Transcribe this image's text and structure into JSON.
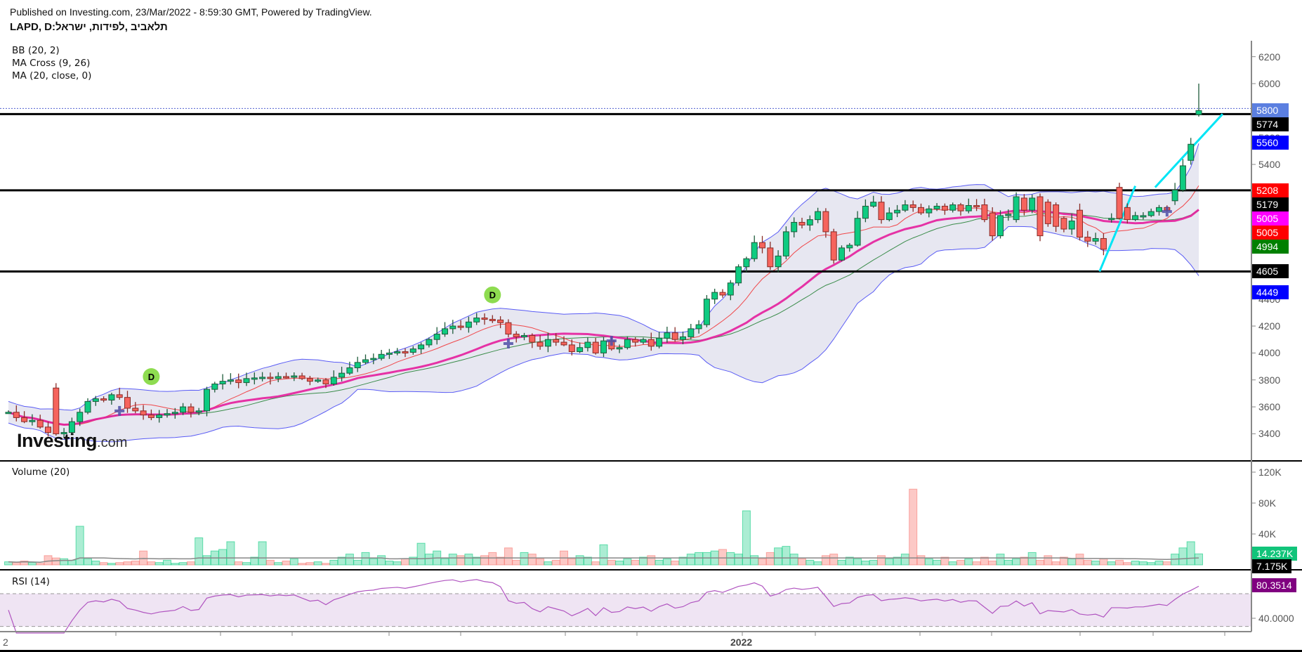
{
  "header": {
    "published": "Published on Investing.com, 23/Mar/2022 - 8:59:30 GMT, Powered by TradingView.",
    "title": "תלאביב ,לפידות, ישראל:LAPD, D",
    "indicators": [
      "BB (20, 2)",
      "MA Cross (9, 26)",
      "MA (20, close, 0)"
    ]
  },
  "logo": {
    "main": "Investing",
    "suffix": ".com"
  },
  "colors": {
    "up": "#0ecb81",
    "up_border": "#1e5c3b",
    "down": "#f6645d",
    "down_border": "#8a2c27",
    "bb_line": "#5a5cf5",
    "bb_fill": "#e4e4f0",
    "ma9": "#f0474a",
    "ma26": "#3a8c4a",
    "ma20": "#e41e9c",
    "level": "#000000",
    "trend": "#00e5f5",
    "rsi": "#b054c0",
    "rsi_band": "#efe4f3",
    "vol_ma": "#888888",
    "marker_d": "#8edc50",
    "cross": "#4f4fa8"
  },
  "chart_data": {
    "type": "candlestick",
    "symbol": "LAPD",
    "interval": "D",
    "close": [
      3560,
      3520,
      3490,
      3500,
      3450,
      3410,
      3400,
      3410,
      3490,
      3560,
      3640,
      3660,
      3650,
      3690,
      3670,
      3590,
      3570,
      3540,
      3520,
      3540,
      3550,
      3560,
      3600,
      3560,
      3570,
      3730,
      3770,
      3790,
      3800,
      3780,
      3810,
      3815,
      3820,
      3810,
      3825,
      3820,
      3830,
      3810,
      3790,
      3800,
      3770,
      3820,
      3850,
      3890,
      3930,
      3950,
      3960,
      3990,
      4000,
      4010,
      4005,
      4030,
      4060,
      4100,
      4140,
      4180,
      4200,
      4190,
      4230,
      4260,
      4250,
      4245,
      4225,
      4140,
      4120,
      4130,
      4080,
      4050,
      4100,
      4080,
      4060,
      4010,
      4040,
      4080,
      4000,
      4090,
      4030,
      4040,
      4100,
      4080,
      4100,
      4050,
      4110,
      4150,
      4100,
      4120,
      4180,
      4210,
      4400,
      4450,
      4430,
      4520,
      4640,
      4700,
      4820,
      4780,
      4640,
      4720,
      4900,
      4970,
      4950,
      4990,
      5050,
      4900,
      4690,
      4780,
      4800,
      5000,
      5090,
      5120,
      4990,
      5040,
      5060,
      5100,
      5080,
      5040,
      5070,
      5090,
      5060,
      5100,
      5055,
      5095,
      5090,
      4990,
      4870,
      5020,
      5030,
      5160,
      5060,
      5150,
      4870,
      4960,
      4940,
      4920,
      4980,
      4860,
      4830,
      4850,
      4770,
      5000,
      5000,
      4990,
      5020,
      5020,
      5050,
      5080,
      5060,
      5210,
      5390,
      5550,
      5800
    ],
    "open_overrides": {
      "6": 3740,
      "123": 5100,
      "124": 5040,
      "127": 4990,
      "128": 5150,
      "130": 5160,
      "131": 5120,
      "132": 5100,
      "133": 5000,
      "135": 5060,
      "138": 4850,
      "139": 4995,
      "140": 5230,
      "141": 5080,
      "147": 5130,
      "149": 5430,
      "150": 5770
    },
    "high_overrides": {
      "150": 6000
    },
    "volume_k": [
      4,
      3,
      5,
      3,
      2,
      12,
      9,
      8,
      6,
      50,
      8,
      5,
      3,
      2,
      3,
      4,
      5,
      18,
      4,
      3,
      6,
      2,
      3,
      4,
      35,
      12,
      18,
      20,
      30,
      4,
      3,
      10,
      30,
      6,
      3,
      5,
      8,
      2,
      3,
      4,
      2,
      6,
      10,
      14,
      6,
      16,
      8,
      12,
      5,
      4,
      8,
      10,
      28,
      14,
      18,
      8,
      14,
      12,
      14,
      10,
      12,
      16,
      10,
      22,
      6,
      16,
      14,
      8,
      4,
      6,
      18,
      8,
      12,
      10,
      4,
      26,
      6,
      5,
      8,
      6,
      10,
      12,
      6,
      8,
      5,
      10,
      14,
      16,
      16,
      18,
      20,
      16,
      14,
      70,
      12,
      8,
      16,
      22,
      24,
      14,
      8,
      6,
      4,
      12,
      14,
      6,
      10,
      8,
      5,
      6,
      12,
      8,
      10,
      14,
      98,
      12,
      8,
      6,
      10,
      4,
      6,
      8,
      4,
      10,
      5,
      14,
      6,
      8,
      10,
      16,
      6,
      12,
      4,
      10,
      8,
      14,
      6,
      5,
      8,
      4,
      6,
      3,
      5,
      4,
      3,
      5,
      4,
      14,
      22,
      30,
      14.237
    ],
    "levels": [
      5774,
      5208,
      4605
    ],
    "last_price_line": 5800,
    "trendlines": [
      [
        [
          137.5,
          4605
        ],
        [
          142,
          5240
        ]
      ],
      [
        [
          144.5,
          5230
        ],
        [
          153,
          5774
        ]
      ]
    ],
    "d_markers": [
      18,
      61
    ],
    "cross_markers": [
      [
        14,
        3570
      ],
      [
        63,
        4070
      ],
      [
        76,
        4090
      ],
      [
        146,
        5050
      ]
    ],
    "price_axis": {
      "min": 3400,
      "max": 6200,
      "step": 200
    },
    "price_badges": [
      {
        "label": "5800",
        "value": 5800,
        "color": "#5b7fe0"
      },
      {
        "label": "5774",
        "value": 5774,
        "color": "#000000"
      },
      {
        "label": "5560",
        "value": 5560,
        "color": "#0000ff"
      },
      {
        "label": "5208",
        "value": 5208,
        "color": "#ff0000"
      },
      {
        "label": "5179",
        "value": 5179,
        "color": "#000000"
      },
      {
        "label": "5005",
        "value": 5005,
        "color": "#ff00ff"
      },
      {
        "label": "5005",
        "value": 5005,
        "color": "#ff0000"
      },
      {
        "label": "4994",
        "value": 4994,
        "color": "#008000"
      },
      {
        "label": "4605",
        "value": 4605,
        "color": "#000000"
      },
      {
        "label": "4449",
        "value": 4449,
        "color": "#0000ff"
      }
    ],
    "volume_pane": {
      "label": "Volume (20)",
      "ticks": [
        "40K",
        "80K",
        "120K"
      ],
      "tick_values": [
        40,
        80,
        120
      ],
      "badges": [
        {
          "label": "14.237K",
          "value": 14.237,
          "color": "#11c47a"
        },
        {
          "label": "7.175K",
          "value": 7.175,
          "color": "#000000"
        }
      ]
    },
    "rsi_pane": {
      "label": "RSI (14)",
      "ticks": [
        "40.0000"
      ],
      "tick_values": [
        40
      ],
      "upper": 70,
      "lower": 30,
      "badge": {
        "label": "80.3514",
        "value": 80.3514,
        "color": "#800080"
      }
    },
    "x_axis": {
      "labels": [
        "2",
        "2022"
      ],
      "label_ticks": [
        -1,
        7
      ],
      "ticks": 14
    }
  }
}
